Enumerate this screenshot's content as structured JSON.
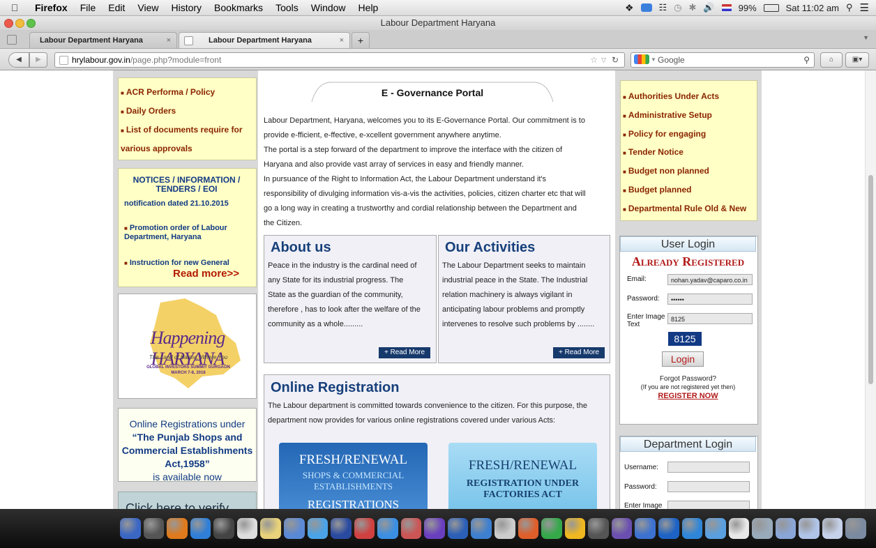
{
  "menubar": {
    "app_name": "Firefox",
    "items": [
      "File",
      "Edit",
      "View",
      "History",
      "Bookmarks",
      "Tools",
      "Window",
      "Help"
    ],
    "battery": "99%",
    "clock": "Sat 11:02 am"
  },
  "window": {
    "title": "Labour Department Haryana"
  },
  "tabs": [
    {
      "label": "Labour Department Haryana",
      "close": "×"
    },
    {
      "label": "Labour Department Haryana",
      "close": "×"
    }
  ],
  "toolbar": {
    "new_tab": "+",
    "url_domain": "hrylabour.gov.in",
    "url_path": "/page.php?module=front",
    "search_placeholder": "Google"
  },
  "left_col": {
    "links": [
      "ACR Performa / Policy",
      "Daily Orders",
      "List of documents require for",
      "various approvals"
    ],
    "notices_title": "NOTICES / INFORMATION / TENDERS / EOI",
    "notices_subtitle": "notification dated 21.10.2015",
    "notices": [
      "Promotion order of Labour Department, Haryana",
      "Instruction for new General"
    ],
    "read_more": "Read more>>",
    "banner": {
      "big_text": "Happening HARYANA",
      "tagline": "The Land of Karma, Where You",
      "summit": "GLOBAL INVESTORS SUMMIT  GURGAON",
      "dates": "MARCH 7-8, 2016"
    },
    "online_reg_note": {
      "line1": "Online Registrations under",
      "quote": "“The Punjab Shops and Commercial Establishments Act,1958”",
      "line3": "is available now"
    },
    "cut_text": "Click here to verify"
  },
  "center": {
    "portal_tab": "E - Governance Portal",
    "intro": [
      "Labour Department, Haryana, welcomes you to its E-Governance Portal. Our commitment is to",
      "provide e-fficient, e-ffective, e-xcellent government anywhere anytime.",
      "The portal is a step forward of the department to improve the interface with the citizen of",
      "Haryana and also provide vast array of services in easy and friendly manner.",
      "In pursuance of the Right to Information Act, the Labour Department understand it's",
      "responsibility of divulging information vis-a-vis the activities, policies, citizen charter etc that will",
      "go a long way in creating a trustworthy and cordial relationship between the Department and",
      "the Citizen."
    ],
    "about": {
      "title": "About us",
      "text": [
        "Peace in the industry is the cardinal need of",
        "any State for its industrial progress. The",
        "State as the guardian of the community,",
        "therefore , has to look after the welfare of the",
        "community as a whole........."
      ],
      "button": "+  Read More"
    },
    "activities": {
      "title": "Our Activities",
      "text": [
        "The Labour Department seeks to maintain",
        "industrial peace in the State. The Industrial",
        "relation machinery is always vigilant in",
        "anticipating labour problems and promptly",
        "intervenes to resolve such problems by ........"
      ],
      "button": "+  Read More"
    },
    "online_reg": {
      "title": "Online Registration",
      "text": [
        "The Labour department is committed towards convenience to the citizen. For this purpose, the",
        "department now provides for various online registrations covered under various Acts:"
      ],
      "card1": [
        "FRESH/RENEWAL",
        "SHOPS & COMMERCIAL",
        "ESTABLISHMENTS",
        "REGISTRATIONS"
      ],
      "card2": [
        "FRESH/RENEWAL",
        "REGISTRATION UNDER",
        "FACTORIES ACT"
      ]
    }
  },
  "right_col": {
    "links": [
      "Authorities Under Acts",
      "Administrative Setup",
      "Policy for engaging",
      "Tender Notice",
      "Budget non planned",
      "Budget planned",
      "Departmental Rule Old & New"
    ],
    "user_login": {
      "title": "User Login",
      "subtitle": "Already Registered",
      "email_label": "Email:",
      "email_value": "nohan.yadav@caparo.co.in",
      "password_label": "Password:",
      "password_value": "••••••",
      "image_text_label": "Enter Image Text",
      "image_text_value": "8125",
      "captcha": "8125",
      "login_btn": "Login",
      "forgot": "Forgot Password?",
      "not_registered": "(If you are not registered yet then)",
      "register": "REGISTER NOW"
    },
    "dept_login": {
      "title": "Department Login",
      "username_label": "Username:",
      "password_label": "Password:",
      "image_text_label": "Enter Image Text"
    }
  },
  "dock": {
    "colors": [
      "#3a66c4",
      "#555",
      "#e07a1c",
      "#2f7fd8",
      "#444",
      "#ddd",
      "#e8d27a",
      "#5a89d6",
      "#4aa3e8",
      "#2a4aa0",
      "#d04040",
      "#3b8fe3",
      "#c55",
      "#6a3fbf",
      "#2b5fb8",
      "#3d7fd0",
      "#ccc",
      "#e05e2a",
      "#35a84a",
      "#f0b820",
      "#555",
      "#6b4fb0",
      "#3c72d0",
      "#1d63c5",
      "#2f86d8",
      "#5aa0e0",
      "#e8e8e8",
      "#9ab",
      "#8aa6d8",
      "#b0c4e8",
      "#c6d2ea",
      "#7a8aa0"
    ]
  }
}
